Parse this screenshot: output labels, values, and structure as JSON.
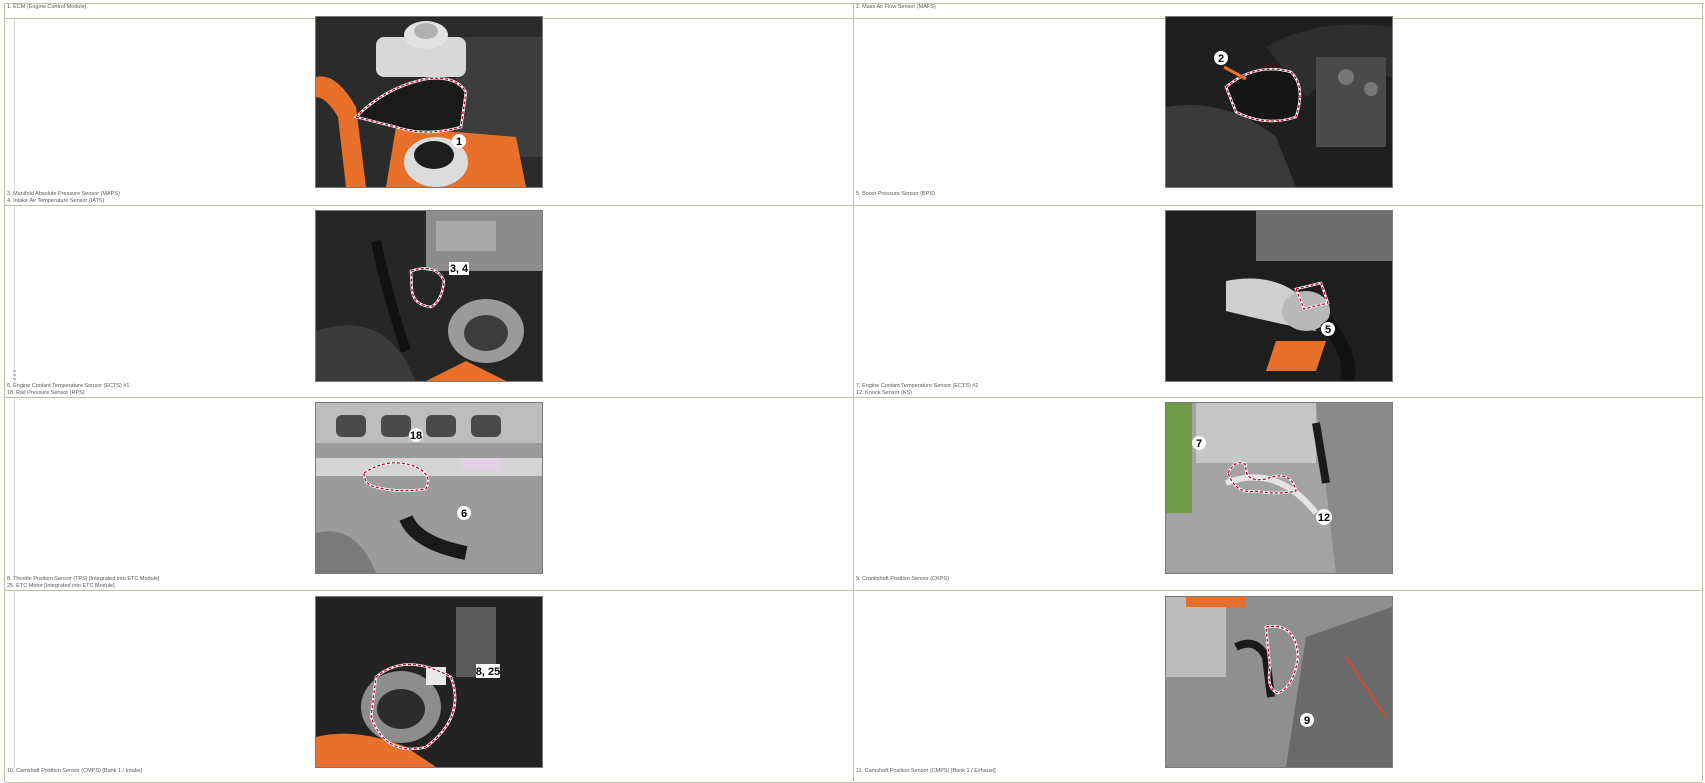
{
  "cells": [
    {
      "lines": [
        "1. ECM (Engine Control Module)"
      ],
      "markers": [
        "1"
      ]
    },
    {
      "lines": [
        "2. Mass Air Flow Sensor (MAFS)"
      ],
      "markers": [
        "2"
      ]
    },
    {
      "lines": [
        "3. Manifold Absolute Pressure Sensor (MAPS)",
        "4. Intake Air Temperature Sensor (IATS)"
      ],
      "markers": [
        "3, 4"
      ]
    },
    {
      "lines": [
        "5. Boost Pressure Sensor (BPS)"
      ],
      "markers": [
        "5"
      ]
    },
    {
      "lines": [
        "6. Engine Coolant Temperature Sensor (ECTS) #1",
        "18. Rail Pressure Sensor (RPS)"
      ],
      "markers": [
        "18",
        "6"
      ]
    },
    {
      "lines": [
        "7. Engine Coolant Temperature Sensor (ECTS) #2",
        "12. Knock Sensor (KS)"
      ],
      "markers": [
        "7",
        "12"
      ]
    },
    {
      "lines": [
        "8. Throttle Position Sensor (TPS) [Integrated into ETC Module]",
        "25. ETC Motor [Integrated into ETC Module]"
      ],
      "markers": [
        "8, 25"
      ]
    },
    {
      "lines": [
        "9. Crankshaft Position Sensor (CKPS)"
      ],
      "markers": [
        "9"
      ]
    },
    {
      "lines": [
        "10. Camshaft Position Sensor (CMPS) [Bank 1 / Intake]"
      ],
      "markers": []
    },
    {
      "lines": [
        "11. Camshaft Position Sensor (CMPS) [Bank 1 / Exhaust]"
      ],
      "markers": []
    }
  ],
  "colors": {
    "grid_line": "#b9c3a6",
    "caption_text": "#5a5a5a",
    "callout_outline": "#c0002a",
    "harness_orange": "#e8702a"
  },
  "icons": {
    "margin_mark": "vertical-text-glyph"
  }
}
